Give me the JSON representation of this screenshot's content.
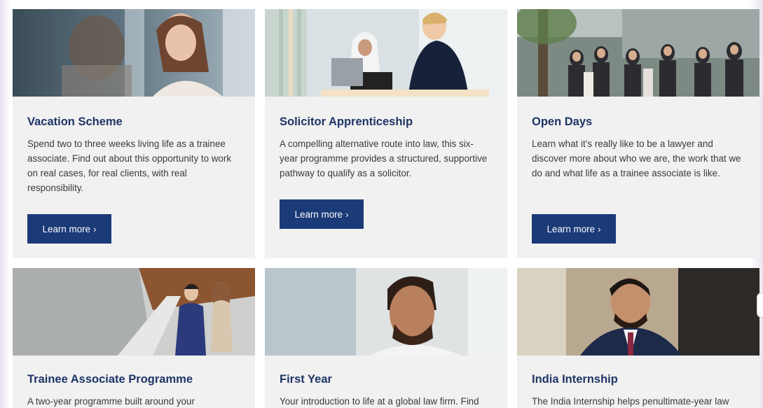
{
  "cards": [
    {
      "title": "Vacation Scheme",
      "desc": "Spend two to three weeks  living life as a trainee associate. Find out about this opportunity to work on real cases, for real clients, with real responsibility.",
      "button": "Learn more",
      "chevron": "›"
    },
    {
      "title": "Solicitor Apprenticeship",
      "desc": "A compelling alternative route into law, this six-year programme provides a structured, supportive pathway to qualify as a solicitor.",
      "button": "Learn more",
      "chevron": "›"
    },
    {
      "title": "Open Days",
      "desc": "Learn what it’s really like to be a lawyer and discover more about who we are, the work that we do and what life as a trainee associate is like.",
      "button": "Learn more",
      "chevron": "›"
    },
    {
      "title": "Trainee Associate Programme",
      "desc": "A two-year programme built around your"
    },
    {
      "title": "First Year",
      "desc": "Your introduction to life at a global law firm. Find"
    },
    {
      "title": "India Internship",
      "desc": "The India Internship helps penultimate-year law"
    }
  ],
  "colors": {
    "title": "#1e3566",
    "button": "#1b3a78",
    "card_bg": "#f1f1f1"
  }
}
